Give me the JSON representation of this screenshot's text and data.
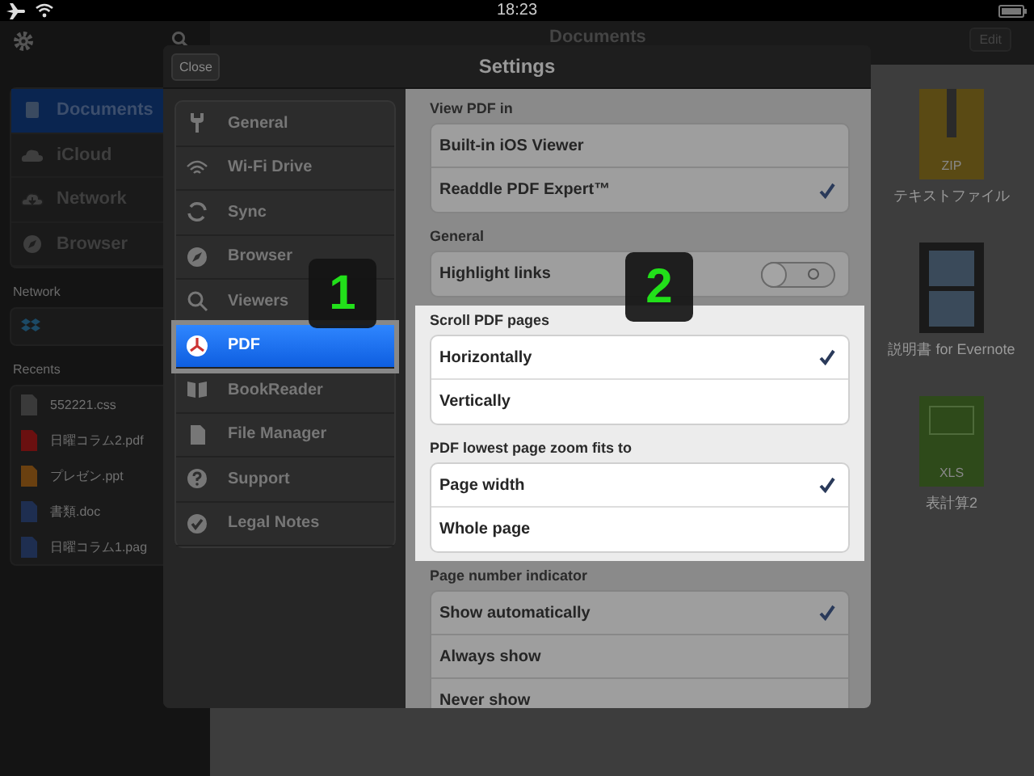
{
  "status_bar": {
    "time": "18:23"
  },
  "sidebar": {
    "places": [
      {
        "label": "Documents",
        "selected": true
      },
      {
        "label": "iCloud",
        "selected": false
      },
      {
        "label": "Network",
        "selected": false
      },
      {
        "label": "Browser",
        "selected": false
      }
    ],
    "network_header": "Network",
    "recents_header": "Recents",
    "recents": [
      {
        "name": "552221.css",
        "kind": "css"
      },
      {
        "name": "日曜コラム2.pdf",
        "kind": "pdf"
      },
      {
        "name": "プレゼン.ppt",
        "kind": "ppt"
      },
      {
        "name": "書類.doc",
        "kind": "doc"
      },
      {
        "name": "日曜コラム1.pag",
        "kind": "pages"
      }
    ]
  },
  "main": {
    "title": "Documents",
    "edit": "Edit",
    "files": [
      {
        "name": "テキストファイル",
        "kind": "zip",
        "badge": "ZIP"
      },
      {
        "name": "説明書 for Evernote",
        "kind": "video"
      },
      {
        "name": "表計算2",
        "kind": "xls",
        "badge": "XLS"
      }
    ]
  },
  "settings": {
    "close": "Close",
    "title": "Settings",
    "menu": [
      {
        "label": "General",
        "selected": false
      },
      {
        "label": "Wi-Fi Drive",
        "selected": false
      },
      {
        "label": "Sync",
        "selected": false
      },
      {
        "label": "Browser",
        "selected": false
      },
      {
        "label": "Viewers",
        "selected": false
      },
      {
        "label": "PDF",
        "selected": true
      },
      {
        "label": "BookReader",
        "selected": false
      },
      {
        "label": "File Manager",
        "selected": false
      },
      {
        "label": "Support",
        "selected": false
      },
      {
        "label": "Legal Notes",
        "selected": false
      }
    ],
    "sections": [
      {
        "header": "View PDF in",
        "highlighted": false,
        "rows": [
          {
            "kind": "option",
            "label": "Built-in iOS Viewer",
            "checked": false
          },
          {
            "kind": "option",
            "label": "Readdle PDF Expert™",
            "checked": true
          }
        ]
      },
      {
        "header": "General",
        "highlighted": false,
        "rows": [
          {
            "kind": "toggle",
            "label": "Highlight links",
            "on": false
          }
        ]
      },
      {
        "header": "Scroll PDF pages",
        "highlighted": true,
        "rows": [
          {
            "kind": "option",
            "label": "Horizontally",
            "checked": true
          },
          {
            "kind": "option",
            "label": "Vertically",
            "checked": false
          }
        ]
      },
      {
        "header": "PDF lowest page zoom fits to",
        "highlighted": true,
        "rows": [
          {
            "kind": "option",
            "label": "Page width",
            "checked": true
          },
          {
            "kind": "option",
            "label": "Whole page",
            "checked": false
          }
        ]
      },
      {
        "header": "Page number indicator",
        "highlighted": false,
        "rows": [
          {
            "kind": "option",
            "label": "Show automatically",
            "checked": true
          },
          {
            "kind": "option",
            "label": "Always show",
            "checked": false
          },
          {
            "kind": "option",
            "label": "Never show",
            "checked": false
          }
        ]
      }
    ]
  },
  "callouts": [
    "1",
    "2"
  ]
}
